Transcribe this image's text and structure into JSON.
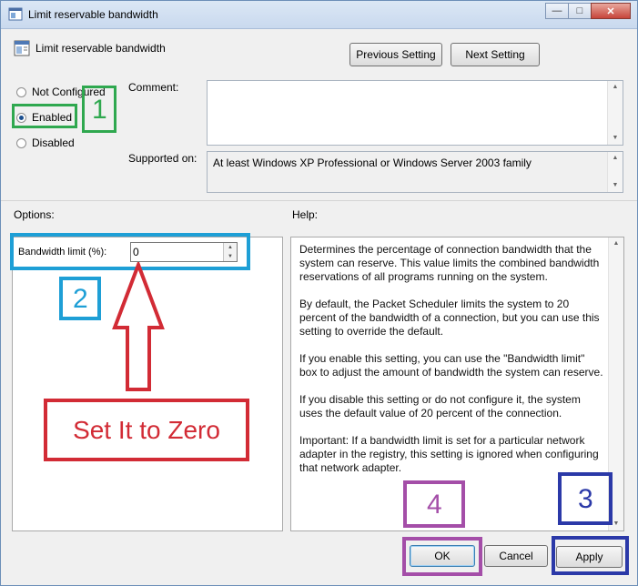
{
  "window": {
    "title": "Limit reservable bandwidth",
    "controls": {
      "minimize": "—",
      "maximize": "□",
      "close": "✕"
    }
  },
  "header": {
    "setting_title": "Limit reservable bandwidth",
    "prev_button": "Previous Setting",
    "next_button": "Next Setting"
  },
  "state": {
    "options": [
      {
        "label": "Not Configured",
        "selected": false
      },
      {
        "label": "Enabled",
        "selected": true
      },
      {
        "label": "Disabled",
        "selected": false
      }
    ]
  },
  "comment_label": "Comment:",
  "comment_value": "",
  "supported_label": "Supported on:",
  "supported_value": "At least Windows XP Professional or Windows Server 2003 family",
  "options_label": "Options:",
  "help_label": "Help:",
  "bandwidth": {
    "label": "Bandwidth limit (%):",
    "value": "0"
  },
  "help_paragraphs": [
    "Determines the percentage of connection bandwidth that the system can reserve. This value limits the combined bandwidth reservations of all programs running on the system.",
    "By default, the Packet Scheduler limits the system to 20 percent of the bandwidth of a connection, but you can use this setting to override the default.",
    "If you enable this setting, you can use the \"Bandwidth limit\" box to adjust the amount of bandwidth the system can reserve.",
    "If you disable this setting or do not configure it, the system uses the default value of 20 percent of the connection.",
    "Important: If a bandwidth limit is set for a particular network adapter in the registry, this setting is ignored when configuring that network adapter."
  ],
  "footer": {
    "ok": "OK",
    "cancel": "Cancel",
    "apply": "Apply"
  },
  "annotations": {
    "step1": "1",
    "step2": "2",
    "step3": "3",
    "step4": "4",
    "instruction": "Set It to Zero",
    "colors": {
      "green": "#2fa84f",
      "blue": "#1e9fd6",
      "red": "#d22b35",
      "purple": "#a44ea8",
      "navy": "#2b39a8"
    }
  }
}
